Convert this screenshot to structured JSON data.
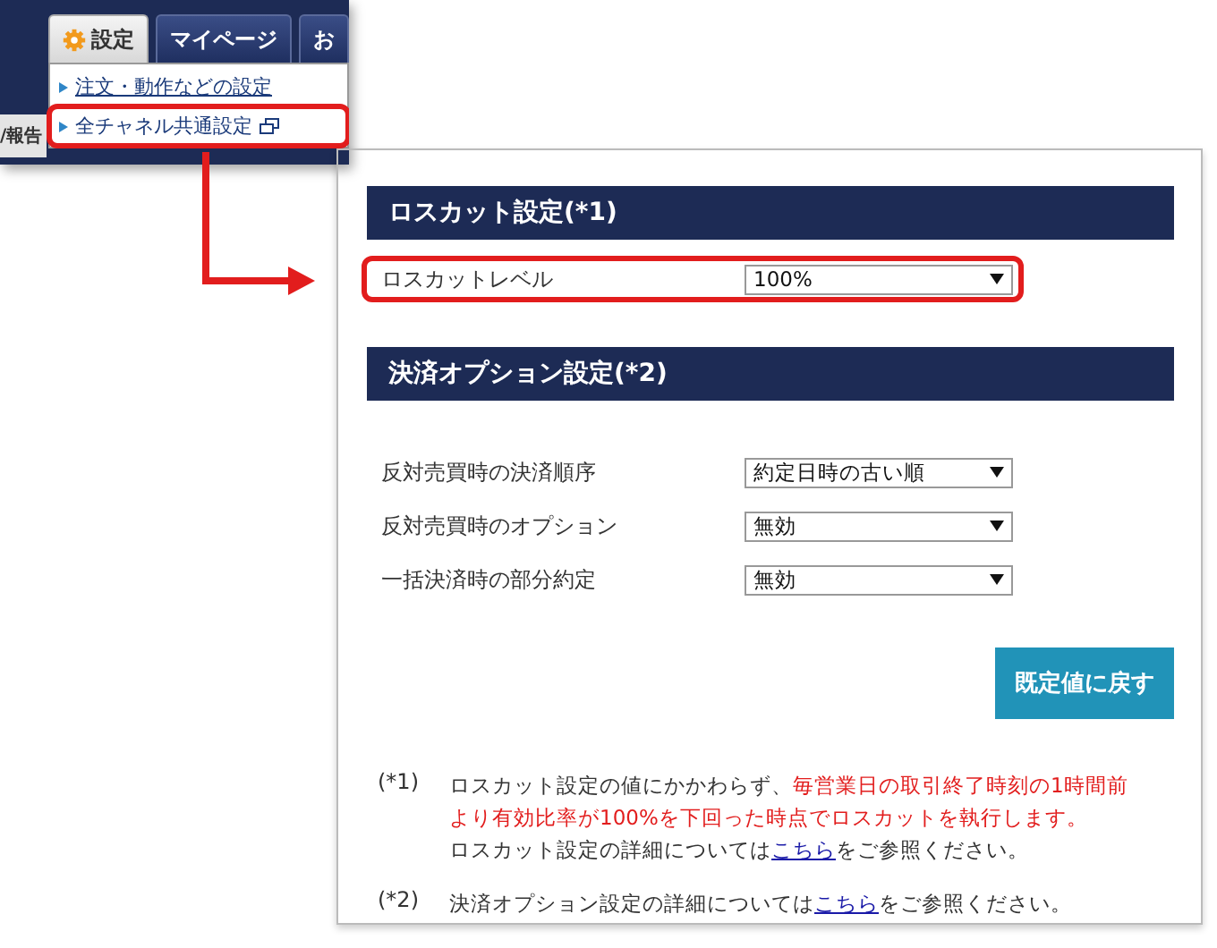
{
  "menu_bar": {
    "tabs": [
      {
        "label": "設定",
        "selected": true
      },
      {
        "label": "マイページ",
        "selected": false
      },
      {
        "label": "お",
        "selected": false
      }
    ],
    "background_tab": "/報告"
  },
  "dropdown": {
    "items": [
      {
        "label": "注文・動作などの設定",
        "kind": "link",
        "highlighted": false
      },
      {
        "label": "全チャネル共通設定",
        "kind": "external",
        "highlighted": true
      }
    ]
  },
  "panel": {
    "sections": [
      {
        "title": "ロスカット設定(*1)",
        "rows": [
          {
            "label": "ロスカットレベル",
            "value": "100%",
            "highlighted": true
          }
        ]
      },
      {
        "title": "決済オプション設定(*2)",
        "rows": [
          {
            "label": "反対売買時の決済順序",
            "value": "約定日時の古い順",
            "highlighted": false
          },
          {
            "label": "反対売買時のオプション",
            "value": "無効",
            "highlighted": false
          },
          {
            "label": "一括決済時の部分約定",
            "value": "無効",
            "highlighted": false
          }
        ]
      }
    ],
    "reset_button": "既定値に戻す",
    "notes": [
      {
        "mark": "(*1)",
        "lines": [
          [
            {
              "kind": "plain",
              "text": "ロスカット設定の値にかかわらず、"
            },
            {
              "kind": "warning",
              "text": "毎営業日の取引終了時刻の1時間前"
            }
          ],
          [
            {
              "kind": "warning",
              "text": "より有効比率が100%を下回った時点でロスカットを執行します。"
            }
          ],
          [
            {
              "kind": "plain",
              "text": "ロスカット設定の詳細については"
            },
            {
              "kind": "link",
              "text": "こちら"
            },
            {
              "kind": "plain",
              "text": "をご参照ください。"
            }
          ]
        ]
      },
      {
        "mark": "(*2)",
        "lines": [
          [
            {
              "kind": "plain",
              "text": "決済オプション設定の詳細については"
            },
            {
              "kind": "link",
              "text": "こちら"
            },
            {
              "kind": "plain",
              "text": "をご参照ください。"
            }
          ]
        ]
      }
    ]
  }
}
